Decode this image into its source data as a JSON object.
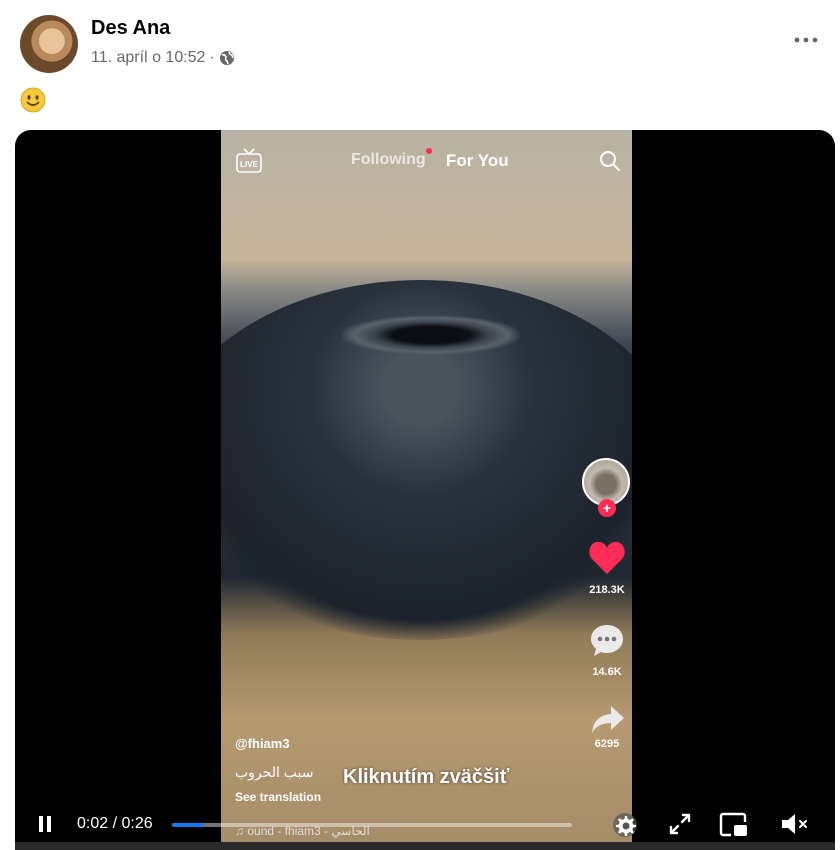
{
  "post": {
    "author": "Des Ana",
    "date": "11. apríl o 10:52",
    "separator": "·",
    "privacy_icon": "globe-icon",
    "more_icon": "more-horizontal-icon",
    "text_emoji": "slightly-smiling-face-emoji"
  },
  "tiktok": {
    "tab_following": "Following",
    "tab_for_you": "For You",
    "live_label": "LIVE",
    "likes": "218.3K",
    "comments": "14.6K",
    "shares": "6295",
    "username": "@fhiam3",
    "caption": "سبب الحروب",
    "see_translation": "See translation",
    "sound": "ound - fhiam3 - الحاسي",
    "accent_color": "#ff2c55"
  },
  "player": {
    "enlarge_hint": "Kliknutím zväčšiť",
    "time": "0:02 / 0:26",
    "progress": 0.077,
    "progress_color": "#1877f2"
  }
}
